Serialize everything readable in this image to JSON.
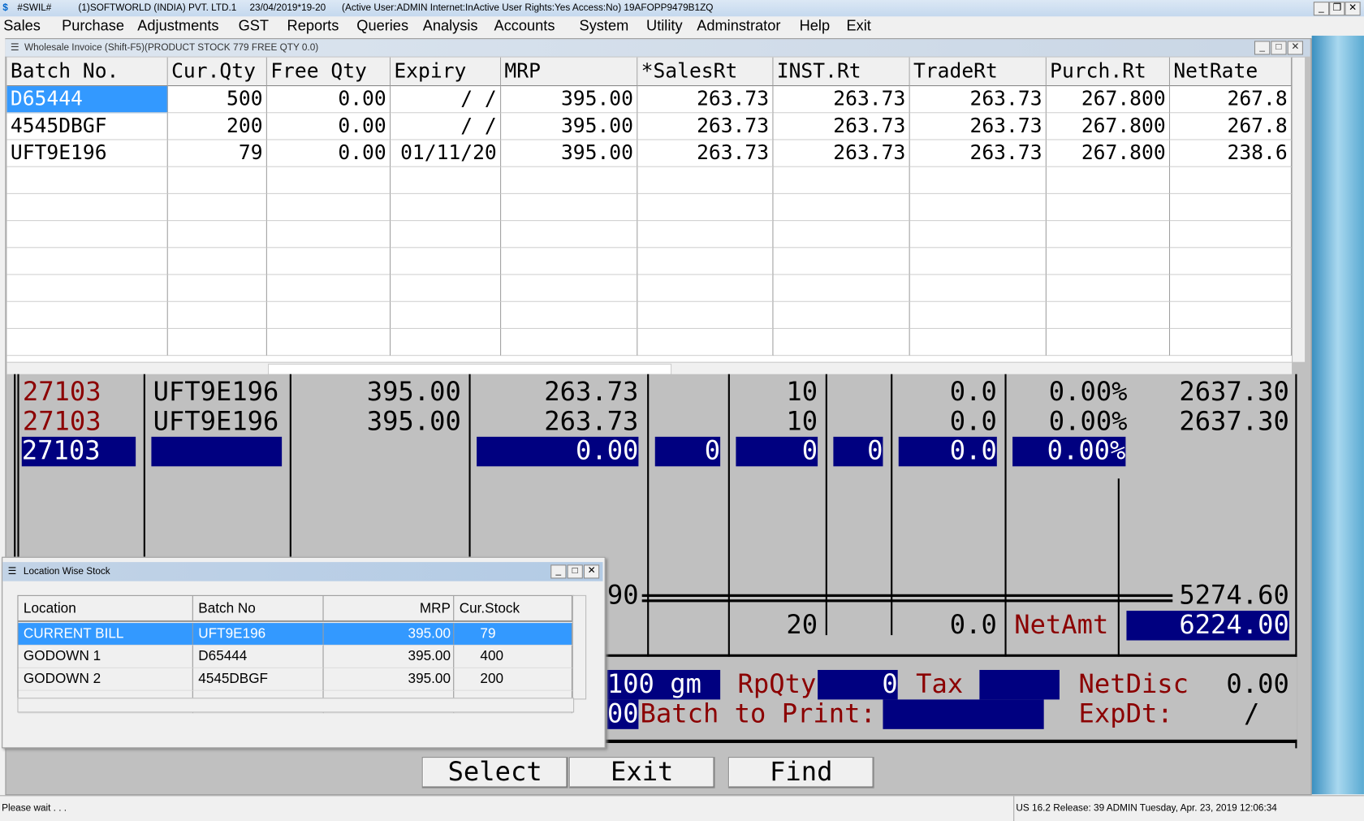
{
  "titlebar": {
    "app": "#SWIL#",
    "company": "(1)SOFTWORLD (INDIA) PVT. LTD.1",
    "date": "23/04/2019*19-20",
    "info": "(Active User:ADMIN Internet:InActive User Rights:Yes Access:No) 19AFOPP9479B1ZQ"
  },
  "menu": [
    "Sales",
    "Purchase",
    "Adjustments",
    "GST",
    "Reports",
    "Queries",
    "Analysis",
    "Accounts",
    "System",
    "Utility",
    "Adminstrator",
    "Help",
    "Exit"
  ],
  "window": {
    "title": "Wholesale Invoice (Shift-F5)(PRODUCT STOCK 779 FREE QTY 0.0)"
  },
  "batch_grid": {
    "columns": [
      "Batch No.",
      "Cur.Qty",
      "Free Qty",
      "Expiry",
      "MRP",
      "*SalesRt",
      "INST.Rt",
      "TradeRt",
      "Purch.Rt",
      "NetRate"
    ],
    "rows": [
      [
        "D65444",
        "500",
        "0.00",
        "/   /",
        "395.00",
        "263.73",
        "263.73",
        "263.73",
        "267.800",
        "267.8"
      ],
      [
        "4545DBGF",
        "200",
        "0.00",
        "/   /",
        "395.00",
        "263.73",
        "263.73",
        "263.73",
        "267.800",
        "267.8"
      ],
      [
        "UFT9E196",
        "79",
        "0.00",
        "01/11/20",
        "395.00",
        "263.73",
        "263.73",
        "263.73",
        "267.800",
        "238.6"
      ]
    ],
    "selected_row": 0
  },
  "invoice_lines": [
    {
      "code": "27103",
      "batch": "UFT9E196",
      "mrp": "395.00",
      "rate": "263.73",
      "qty": "10",
      "disc": "0.0",
      "pct": "0.00%",
      "amount": "2637.30"
    },
    {
      "code": "27103",
      "batch": "UFT9E196",
      "mrp": "395.00",
      "rate": "263.73",
      "qty": "10",
      "disc": "0.0",
      "pct": "0.00%",
      "amount": "2637.30"
    }
  ],
  "entry_line": {
    "code": "27103",
    "batch": "",
    "rate": "0.00",
    "f1": "0",
    "qty": "0",
    "f2": "0",
    "disc": "0.0",
    "pct": "0.00%"
  },
  "totals": {
    "left": "90",
    "total": "5274.60",
    "qty": "20",
    "disc": "0.0",
    "netamt_label": "NetAmt",
    "netamt": "6224.00"
  },
  "footer": {
    "pack": "100 gm",
    "rpqty_label": "RpQty",
    "rpqty": "0",
    "tax_label": "Tax",
    "tax": "",
    "netdisc_label": "NetDisc",
    "netdisc": "0.00",
    "prefix": "00",
    "batch_print_label": "Batch to Print:",
    "batch_print": "",
    "expdt_label": "ExpDt:",
    "expdt": "/"
  },
  "buttons": {
    "select": "Select",
    "exit": "Exit",
    "find": "Find"
  },
  "location_stock": {
    "title": "Location Wise Stock",
    "columns": [
      "Location",
      "Batch No",
      "MRP",
      "Cur.Stock"
    ],
    "rows": [
      [
        "CURRENT BILL",
        "UFT9E196",
        "395.00",
        "79"
      ],
      [
        "GODOWN 1",
        "D65444",
        "395.00",
        "400"
      ],
      [
        "GODOWN 2",
        "4545DBGF",
        "395.00",
        "200"
      ]
    ],
    "selected_row": 0
  },
  "status": {
    "left": "Please wait . . .",
    "right": "US 16.2 Release: 39  ADMIN  Tuesday, Apr. 23, 2019  12:06:34"
  },
  "colors": {
    "highlight": "#000080",
    "selection": "#3399ff",
    "label_red": "#8b0000",
    "panel": "#c0c0c0"
  }
}
